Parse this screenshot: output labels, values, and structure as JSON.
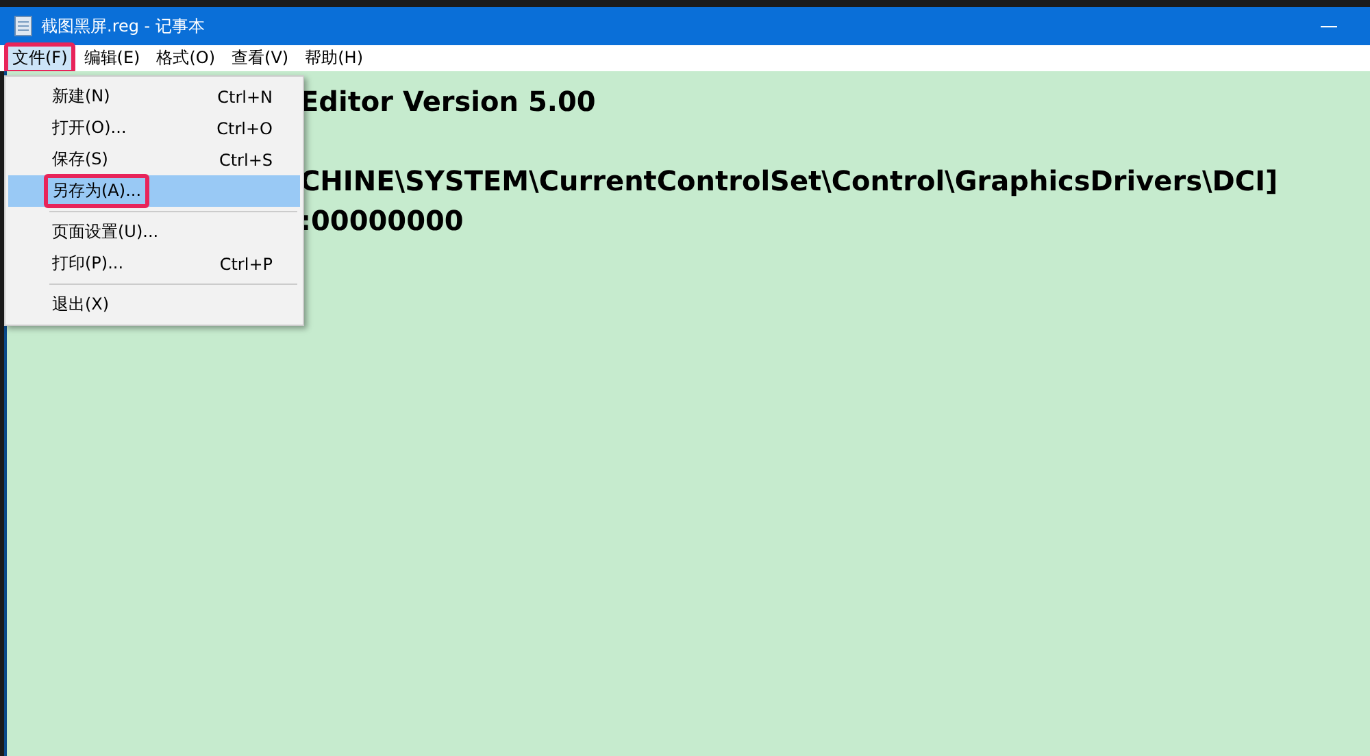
{
  "window": {
    "title": "截图黑屏.reg - 记事本"
  },
  "menu_bar": [
    {
      "label": "文件(F)",
      "selected": true,
      "highlighted": true
    },
    {
      "label": "编辑(E)",
      "selected": false,
      "highlighted": false
    },
    {
      "label": "格式(O)",
      "selected": false,
      "highlighted": false
    },
    {
      "label": "查看(V)",
      "selected": false,
      "highlighted": false
    },
    {
      "label": "帮助(H)",
      "selected": false,
      "highlighted": false
    }
  ],
  "file_menu": [
    {
      "kind": "item",
      "label": "新建(N)",
      "shortcut": "Ctrl+N",
      "selected": false,
      "highlighted": false
    },
    {
      "kind": "item",
      "label": "打开(O)...",
      "shortcut": "Ctrl+O",
      "selected": false,
      "highlighted": false
    },
    {
      "kind": "item",
      "label": "保存(S)",
      "shortcut": "Ctrl+S",
      "selected": false,
      "highlighted": false
    },
    {
      "kind": "item",
      "label": "另存为(A)...",
      "selected": true,
      "highlighted": true
    },
    {
      "kind": "separator"
    },
    {
      "kind": "item",
      "label": "页面设置(U)...",
      "selected": false,
      "highlighted": false
    },
    {
      "kind": "item",
      "label": "打印(P)...",
      "shortcut": "Ctrl+P",
      "selected": false,
      "highlighted": false
    },
    {
      "kind": "separator"
    },
    {
      "kind": "item",
      "label": "退出(X)",
      "selected": false,
      "highlighted": false
    }
  ],
  "editor": {
    "lines": [
      "Editor Version 5.00",
      "CHINE\\SYSTEM\\CurrentControlSet\\Control\\GraphicsDrivers\\DCI]",
      ":00000000"
    ]
  }
}
